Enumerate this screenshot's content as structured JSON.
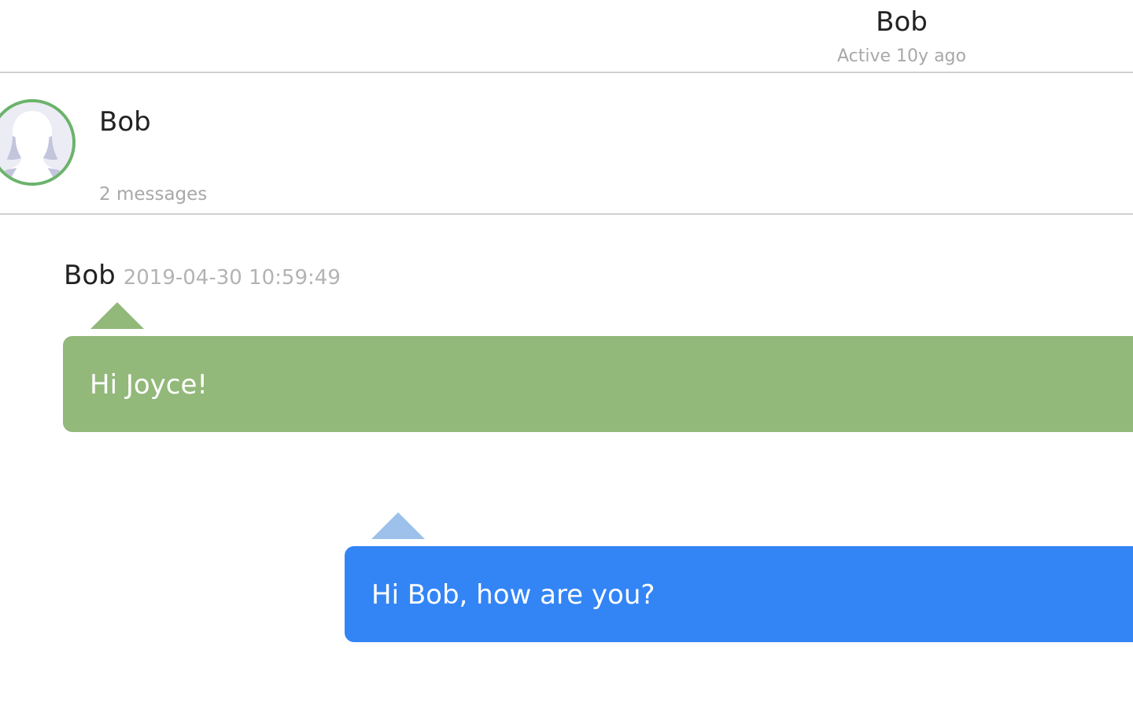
{
  "header": {
    "title": "Bob",
    "status": "Active 10y ago"
  },
  "contact": {
    "name": "Bob",
    "message_count": "2 messages",
    "avatar_icon": "user-silhouette-icon",
    "avatar_ring_color": "#6bb36b"
  },
  "messages": [
    {
      "sender": "Bob",
      "timestamp": "2019-04-30 10:59:49",
      "text": "Hi Joyce!",
      "color": "#92b87a"
    },
    {
      "text": "Hi Bob, how are you?",
      "color": "#3385f6"
    }
  ]
}
